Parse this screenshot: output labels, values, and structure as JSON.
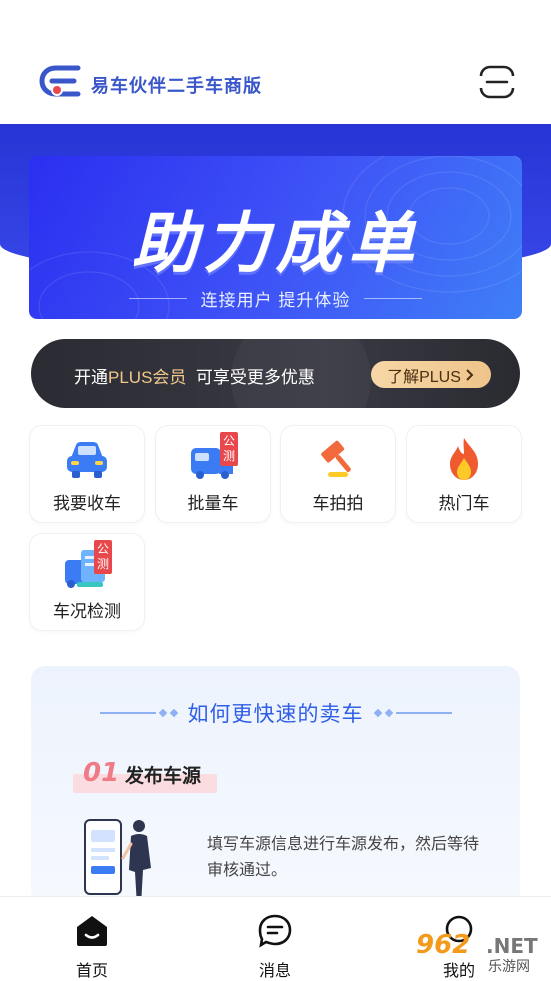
{
  "header": {
    "app_title": "易车伙伴二手车商版",
    "logo_icon": "yiche-logo-icon",
    "scan_icon": "scan-icon"
  },
  "banner": {
    "title": "助力成单",
    "subtitle": "连接用户  提升体验"
  },
  "plus_bar": {
    "prefix": "开通",
    "highlight": "PLUS会员",
    "suffix": "  可享受更多优惠",
    "button_label": "了解PLUS",
    "accent": "#f1c98d"
  },
  "grid": {
    "badge_text": "公测",
    "items": [
      {
        "label": "我要收车",
        "icon": "car-front-icon"
      },
      {
        "label": "批量车",
        "icon": "truck-icon",
        "badge": true
      },
      {
        "label": "车拍拍",
        "icon": "auction-hammer-icon"
      },
      {
        "label": "热门车",
        "icon": "fire-icon"
      },
      {
        "label": "车况检测",
        "icon": "car-inspection-icon",
        "badge": true
      }
    ]
  },
  "info_card": {
    "title": "如何更快速的卖车",
    "step_number": "01",
    "step_title": "发布车源",
    "step_desc": "填写车源信息进行车源发布，然后等待审核通过。"
  },
  "bottom_nav": {
    "items": [
      {
        "label": "首页",
        "icon": "home-icon",
        "active": true
      },
      {
        "label": "消息",
        "icon": "message-icon"
      },
      {
        "label": "我的",
        "icon": "profile-icon"
      }
    ]
  },
  "watermark": {
    "big": "962",
    "net": ".NET",
    "sub": "乐游网"
  },
  "colors": {
    "brand_blue": "#2f5ee8",
    "hero_blue": "#2735d6",
    "badge_red": "#e8474b"
  }
}
